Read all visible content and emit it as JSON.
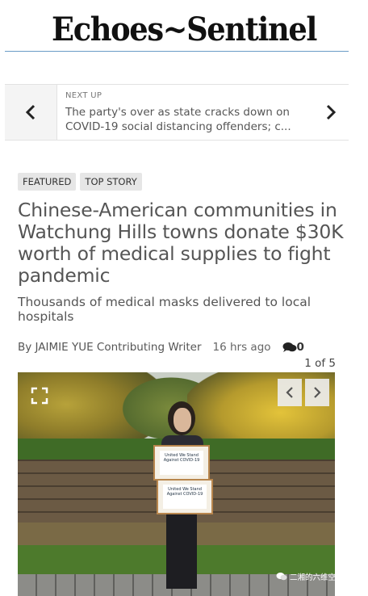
{
  "masthead": {
    "title": "Echoes~Sentinel"
  },
  "next_up": {
    "label": "NEXT UP",
    "headline": "The party's over as state cracks down on COVID-19 social distancing offenders; c..."
  },
  "article": {
    "tags": [
      "FEATURED",
      "TOP STORY"
    ],
    "headline": "Chinese-American communities in Watchung Hills towns donate $30K worth of medical supplies to fight pandemic",
    "subhead": "Thousands of medical masks delivered to local hospitals",
    "byline": "By JAIMIE YUE Contributing Writer",
    "time": "16 hrs ago",
    "comment_count": "0"
  },
  "gallery": {
    "counter": "1 of 5",
    "box_label": "United We Stand Against COVID-19"
  },
  "watermark": {
    "text": "二湘的六维空间"
  },
  "colors": {
    "rule": "#6a9bc7",
    "tag_bg": "#e6e6e6",
    "headline": "#555555"
  },
  "icons": {
    "prev": "chevron-left-icon",
    "next": "chevron-right-icon",
    "comments": "comment-bubble-icon",
    "expand": "expand-icon"
  }
}
